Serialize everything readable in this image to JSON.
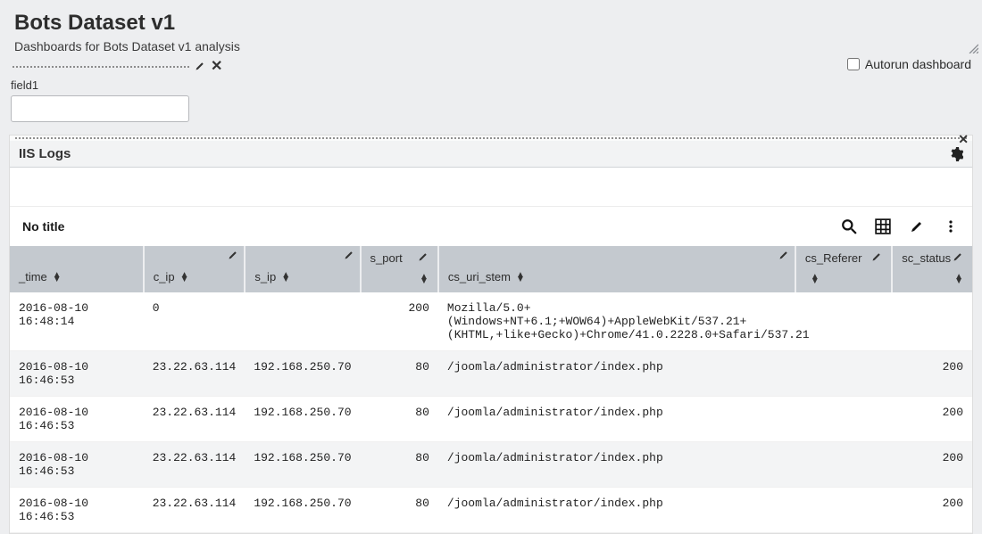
{
  "header": {
    "title": "Bots Dataset v1",
    "subtitle": "Dashboards for Bots Dataset v1 analysis"
  },
  "autorun_label": "Autorun dashboard",
  "input_row": {
    "field_label": "field1",
    "field_value": ""
  },
  "panel": {
    "title": "IIS Logs",
    "viz_title": "No title"
  },
  "columns": {
    "time": "_time",
    "cip": "c_ip",
    "sip": "s_ip",
    "sport": "s_port",
    "csuri": "cs_uri_stem",
    "csref": "cs_Referer",
    "scstatus": "sc_status"
  },
  "rows": [
    {
      "time": "2016-08-10 16:48:14",
      "cip": "0",
      "sip": "",
      "sport": "200",
      "csuri": "Mozilla/5.0+(Windows+NT+6.1;+WOW64)+AppleWebKit/537.21+(KHTML,+like+Gecko)+Chrome/41.0.2228.0+Safari/537.21",
      "csref": "",
      "scstatus": ""
    },
    {
      "time": "2016-08-10 16:46:53",
      "cip": "23.22.63.114",
      "sip": "192.168.250.70",
      "sport": "80",
      "csuri": "/joomla/administrator/index.php",
      "csref": "",
      "scstatus": "200"
    },
    {
      "time": "2016-08-10 16:46:53",
      "cip": "23.22.63.114",
      "sip": "192.168.250.70",
      "sport": "80",
      "csuri": "/joomla/administrator/index.php",
      "csref": "",
      "scstatus": "200"
    },
    {
      "time": "2016-08-10 16:46:53",
      "cip": "23.22.63.114",
      "sip": "192.168.250.70",
      "sport": "80",
      "csuri": "/joomla/administrator/index.php",
      "csref": "",
      "scstatus": "200"
    },
    {
      "time": "2016-08-10 16:46:53",
      "cip": "23.22.63.114",
      "sip": "192.168.250.70",
      "sport": "80",
      "csuri": "/joomla/administrator/index.php",
      "csref": "",
      "scstatus": "200"
    }
  ]
}
